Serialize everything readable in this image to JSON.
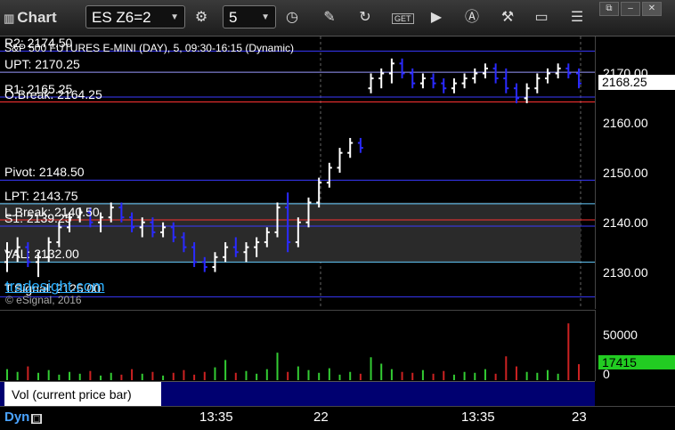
{
  "toolbar": {
    "title": "Chart",
    "symbol": "ES Z6=2",
    "interval": "5"
  },
  "chart": {
    "title": "S&P 500 FUTURES E-MINI (DAY), 5, 09:30-16:15 (Dynamic)",
    "current_price": "2168.25",
    "watermark": "tradesight.com",
    "copyright": "© eSignal, 2016",
    "levels": [
      {
        "label": "R2: 2174.50",
        "value": 2174.5,
        "color": "#3a3aff"
      },
      {
        "label": "UPT: 2170.25",
        "value": 2170.25,
        "color": "#9a9aff"
      },
      {
        "label": "R1: 2165.25",
        "value": 2165.25,
        "color": "#3a3aff"
      },
      {
        "label": "O.Break: 2164.25",
        "value": 2164.25,
        "color": "#ff3333"
      },
      {
        "label": "Pivot: 2148.50",
        "value": 2148.5,
        "color": "#3a3aff"
      },
      {
        "label": "LPT: 2143.75",
        "value": 2143.75,
        "color": "#66ccff"
      },
      {
        "label": "L.Break: 2140.50",
        "value": 2140.5,
        "color": "#ff3333"
      },
      {
        "label": "S1: 2139.25",
        "value": 2139.25,
        "color": "#3a3aff"
      },
      {
        "label": "VAL: 2132.00",
        "value": 2132.0,
        "color": "#66ccff"
      },
      {
        "label": "T.Signal: 2125.00",
        "value": 2125.0,
        "color": "#3a3aff"
      }
    ],
    "axis_ticks": [
      "2170.00",
      "2160.00",
      "2150.00",
      "2140.00",
      "2130.00"
    ]
  },
  "volume": {
    "legend": "Vol (current price bar)",
    "current": "17415",
    "ticks": [
      "50000",
      "0"
    ]
  },
  "time_axis": {
    "brand": "Dyn",
    "labels": [
      "13:35",
      "22",
      "13:35",
      "23"
    ]
  },
  "chart_data": {
    "type": "bar",
    "ylim": [
      2124,
      2176
    ],
    "bars": [
      [
        2132,
        2136,
        2130,
        2134
      ],
      [
        2134,
        2137,
        2132,
        2135
      ],
      [
        2135,
        2136,
        2131,
        2132
      ],
      [
        2132,
        2134,
        2129,
        2133
      ],
      [
        2133,
        2137,
        2132,
        2136
      ],
      [
        2136,
        2140,
        2135,
        2139
      ],
      [
        2139,
        2142,
        2138,
        2141
      ],
      [
        2141,
        2143,
        2140,
        2142
      ],
      [
        2142,
        2143,
        2139,
        2140
      ],
      [
        2140,
        2142,
        2138,
        2141
      ],
      [
        2141,
        2144,
        2140,
        2143
      ],
      [
        2143,
        2144,
        2140,
        2141
      ],
      [
        2141,
        2142,
        2138,
        2139
      ],
      [
        2139,
        2141,
        2137,
        2140
      ],
      [
        2140,
        2141,
        2137,
        2138
      ],
      [
        2138,
        2140,
        2137,
        2139
      ],
      [
        2139,
        2140,
        2136,
        2137
      ],
      [
        2137,
        2138,
        2134,
        2135
      ],
      [
        2135,
        2136,
        2131,
        2132
      ],
      [
        2132,
        2133,
        2130,
        2131
      ],
      [
        2131,
        2134,
        2130,
        2133
      ],
      [
        2133,
        2136,
        2132,
        2135
      ],
      [
        2135,
        2137,
        2133,
        2134
      ],
      [
        2134,
        2136,
        2132,
        2135
      ],
      [
        2135,
        2137,
        2133,
        2136
      ],
      [
        2136,
        2139,
        2135,
        2138
      ],
      [
        2138,
        2144,
        2137,
        2143
      ],
      [
        2143,
        2146,
        2134,
        2136
      ],
      [
        2136,
        2141,
        2135,
        2140
      ],
      [
        2140,
        2145,
        2139,
        2144
      ],
      [
        2144,
        2149,
        2143,
        2148
      ],
      [
        2148,
        2152,
        2147,
        2151
      ],
      [
        2151,
        2155,
        2150,
        2154
      ],
      [
        2154,
        2157,
        2153,
        2156
      ],
      [
        2156,
        2157,
        2154,
        2155
      ],
      [
        2167,
        2170,
        2166,
        2169
      ],
      [
        2169,
        2171,
        2167,
        2170
      ],
      [
        2170,
        2173,
        2168,
        2172
      ],
      [
        2172,
        2173,
        2169,
        2170
      ],
      [
        2170,
        2171,
        2167,
        2168
      ],
      [
        2168,
        2170,
        2167,
        2169
      ],
      [
        2169,
        2170,
        2167,
        2168
      ],
      [
        2168,
        2169,
        2166,
        2167
      ],
      [
        2167,
        2169,
        2166,
        2168
      ],
      [
        2168,
        2170,
        2167,
        2169
      ],
      [
        2169,
        2171,
        2168,
        2170
      ],
      [
        2170,
        2172,
        2169,
        2171
      ],
      [
        2171,
        2172,
        2168,
        2169
      ],
      [
        2169,
        2171,
        2166,
        2167
      ],
      [
        2167,
        2168,
        2164,
        2165
      ],
      [
        2165,
        2168,
        2164,
        2167
      ],
      [
        2167,
        2170,
        2166,
        2169
      ],
      [
        2169,
        2171,
        2168,
        2170
      ],
      [
        2170,
        2172,
        2169,
        2171
      ],
      [
        2171,
        2172,
        2169,
        2170
      ],
      [
        2170,
        2171,
        2167,
        2168
      ]
    ],
    "volumes": [
      12000,
      9000,
      15000,
      8000,
      11000,
      6000,
      9000,
      7000,
      10000,
      5000,
      8000,
      6000,
      12000,
      7000,
      9000,
      5000,
      8000,
      11000,
      6000,
      9000,
      14000,
      22000,
      8000,
      10000,
      7000,
      12000,
      30000,
      9000,
      15000,
      11000,
      8000,
      13000,
      6000,
      9000,
      7000,
      25000,
      18000,
      12000,
      9000,
      8000,
      11000,
      7000,
      10000,
      6000,
      9000,
      8000,
      12000,
      7000,
      26000,
      15000,
      9000,
      8000,
      11000,
      7000,
      62000,
      17415
    ]
  }
}
